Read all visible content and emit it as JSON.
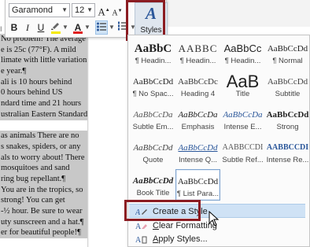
{
  "mini_toolbar": {
    "font_name": "Garamond",
    "font_size": "12",
    "grow_font": "A",
    "shrink_font": "A",
    "bold": "B",
    "italic": "I",
    "underline": "U",
    "font_color_letter": "A",
    "highlight_color": "#f5e900",
    "font_color": "#e02020",
    "styles_label": "Styles",
    "styles_glyph": "A"
  },
  "document": {
    "lines": [
      "No problem! The average",
      "e is 25c (77°F). A mild",
      "limate with little variation",
      "e year.¶",
      "ali is 10 hours behind",
      "0 hours behind US",
      "ndard time and 21 hours",
      "ustralian Eastern Standard",
      "",
      "as animals There are no",
      "s snakes, spiders, or any",
      "als to worry about! There",
      "mosquitoes and sand",
      "ring bug repellant.¶",
      "You are in the tropics, so",
      "strong! You can get",
      "-½ hour. Be sure to wear",
      "uty sunscreen and a hat.¶",
      "er for beautiful people!¶"
    ],
    "left_marker": "I"
  },
  "gallery": {
    "tiles": [
      {
        "sample": "AaBbC",
        "name": "¶ Headin..."
      },
      {
        "sample": "AABBC",
        "name": "¶ Headin..."
      },
      {
        "sample": "AaBbCc",
        "name": "¶ Headin..."
      },
      {
        "sample": "AaBbCcDd",
        "name": "¶ Normal"
      },
      {
        "sample": "AaBbCcDd",
        "name": "¶ No Spac..."
      },
      {
        "sample": "AaBbCcDc",
        "name": "Heading 4"
      },
      {
        "sample": "AaB",
        "name": "Title"
      },
      {
        "sample": "AaBbCcDd",
        "name": "Subtitle"
      },
      {
        "sample": "AaBbCcDa",
        "name": "Subtle Em..."
      },
      {
        "sample": "AaBbCcDa",
        "name": "Emphasis"
      },
      {
        "sample": "AaBbCcDa",
        "name": "Intense E..."
      },
      {
        "sample": "AaBbCcDd",
        "name": "Strong"
      },
      {
        "sample": "AaBbCcDd",
        "name": "Quote"
      },
      {
        "sample": "AaBbCcDd",
        "name": "Intense Q..."
      },
      {
        "sample": "AABBCCDI",
        "name": "Subtle Ref..."
      },
      {
        "sample": "AABBCCDI",
        "name": "Intense Re..."
      },
      {
        "sample": "AaBbCcDd",
        "name": "Book Title"
      },
      {
        "sample": "AaBbCcDd",
        "name": "¶ List Para..."
      }
    ]
  },
  "commands": {
    "create_style": "Create a Style",
    "clear_formatting_prefix": "C",
    "clear_formatting_rest": "lear Formatting",
    "apply_styles_prefix": "A",
    "apply_styles_rest": "pply Styles..."
  },
  "colors": {
    "highlight_box": "#8b1c22",
    "selection": "#c8c8c8",
    "menu_hover": "#cfe2f5",
    "accent": "#2b579a"
  }
}
